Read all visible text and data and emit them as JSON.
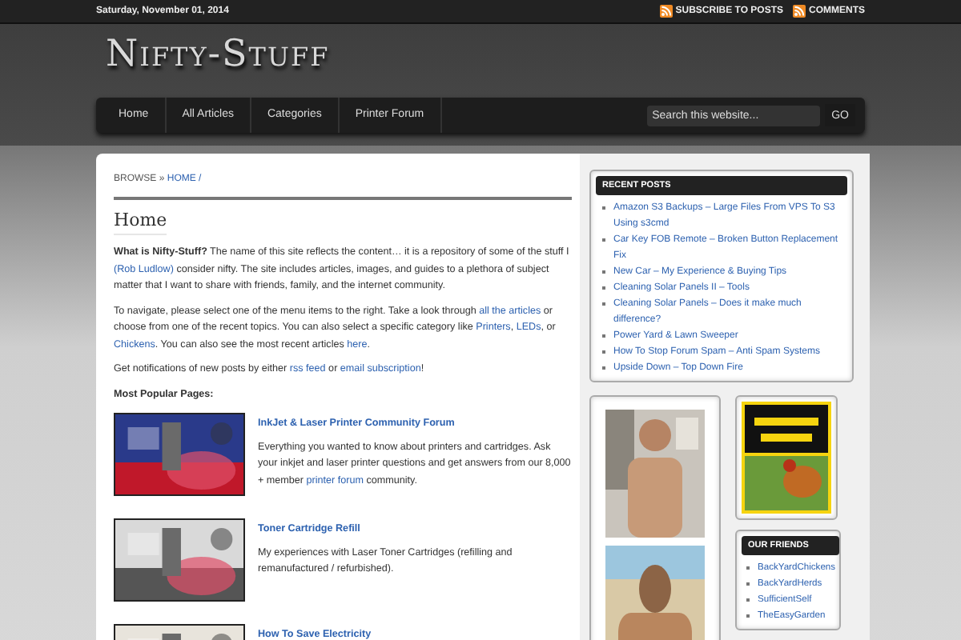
{
  "top_bar": {
    "date": "Saturday, November 01, 2014",
    "links": [
      "SUBSCRIBE TO POSTS",
      "COMMENTS"
    ]
  },
  "site_title": "Nifty-Stuff",
  "nav": {
    "items": [
      {
        "label": "Home"
      },
      {
        "label": "All Articles"
      },
      {
        "label": "Categories"
      },
      {
        "label": "Printer Forum"
      }
    ],
    "search": {
      "placeholder": "Search this website..."
    },
    "go_button": "GO"
  },
  "breadcrumb": {
    "label": "BROWSE »",
    "current": "HOME /"
  },
  "page_title": "Home",
  "paragraphs": [
    [
      {
        "kind": "bold",
        "text": "What is Nifty-Stuff?"
      },
      {
        "kind": "text",
        "text": " The name of this site reflects the content… it is a repository of some of the stuff I "
      },
      {
        "kind": "link",
        "text": "(Rob Ludlow)"
      },
      {
        "kind": "text",
        "text": " consider nifty. The site includes articles, images, and guides to a plethora of subject matter that I want to share with friends, family, and the internet community."
      }
    ],
    [
      {
        "kind": "text",
        "text": "To navigate, please select one of the menu items to the right. Take a look through "
      },
      {
        "kind": "link",
        "text": "all the articles"
      },
      {
        "kind": "text",
        "text": " or choose from one of the recent topics. You can also select a specific category like "
      },
      {
        "kind": "link",
        "text": "Printers"
      },
      {
        "kind": "text",
        "text": ", "
      },
      {
        "kind": "link",
        "text": "LEDs"
      },
      {
        "kind": "text",
        "text": ", or "
      },
      {
        "kind": "link",
        "text": "Chickens"
      },
      {
        "kind": "text",
        "text": ".  You can also see the most recent articles "
      },
      {
        "kind": "link",
        "text": "here"
      },
      {
        "kind": "text",
        "text": "."
      }
    ],
    [
      {
        "kind": "text",
        "text": "Get notifications of new posts by either "
      },
      {
        "kind": "link",
        "text": "rss feed"
      },
      {
        "kind": "text",
        "text": " or "
      },
      {
        "kind": "link",
        "text": "email subscription"
      },
      {
        "kind": "text",
        "text": "!"
      }
    ]
  ],
  "popular_heading": "Most Popular Pages:",
  "articles": [
    {
      "title": "InkJet & Laser Printer Community Forum",
      "summary": [
        {
          "kind": "text",
          "text": "Everything you wanted to know about printers and cartridges. Ask your inkjet and laser printer questions and get answers from our 8,000 + member "
        },
        {
          "kind": "link",
          "text": "printer forum"
        },
        {
          "kind": "text",
          "text": " community."
        }
      ]
    },
    {
      "title": "Toner Cartridge Refill",
      "summary": [
        {
          "kind": "text",
          "text": "My experiences with Laser Toner Cartridges (refilling and remanufactured / refurbished)."
        }
      ]
    },
    {
      "title": "How To Save Electricity"
    }
  ],
  "recent_posts": {
    "title": "RECENT POSTS",
    "items": [
      "Amazon S3 Backups – Large Files From VPS To S3 Using s3cmd",
      "Car Key FOB Remote – Broken Button Replacement Fix",
      "New Car – My Experience & Buying Tips",
      "Cleaning Solar Panels II – Tools",
      "Cleaning Solar Panels – Does it make much difference?",
      "Power Yard & Lawn Sweeper",
      "How To Stop Forum Spam – Anti Spam Systems",
      "Upside Down – Top Down Fire"
    ]
  },
  "friends": {
    "title": "OUR FRIENDS",
    "items": [
      "BackYardChickens",
      "BackYardHerds",
      "SufficientSelf",
      "TheEasyGarden"
    ]
  }
}
